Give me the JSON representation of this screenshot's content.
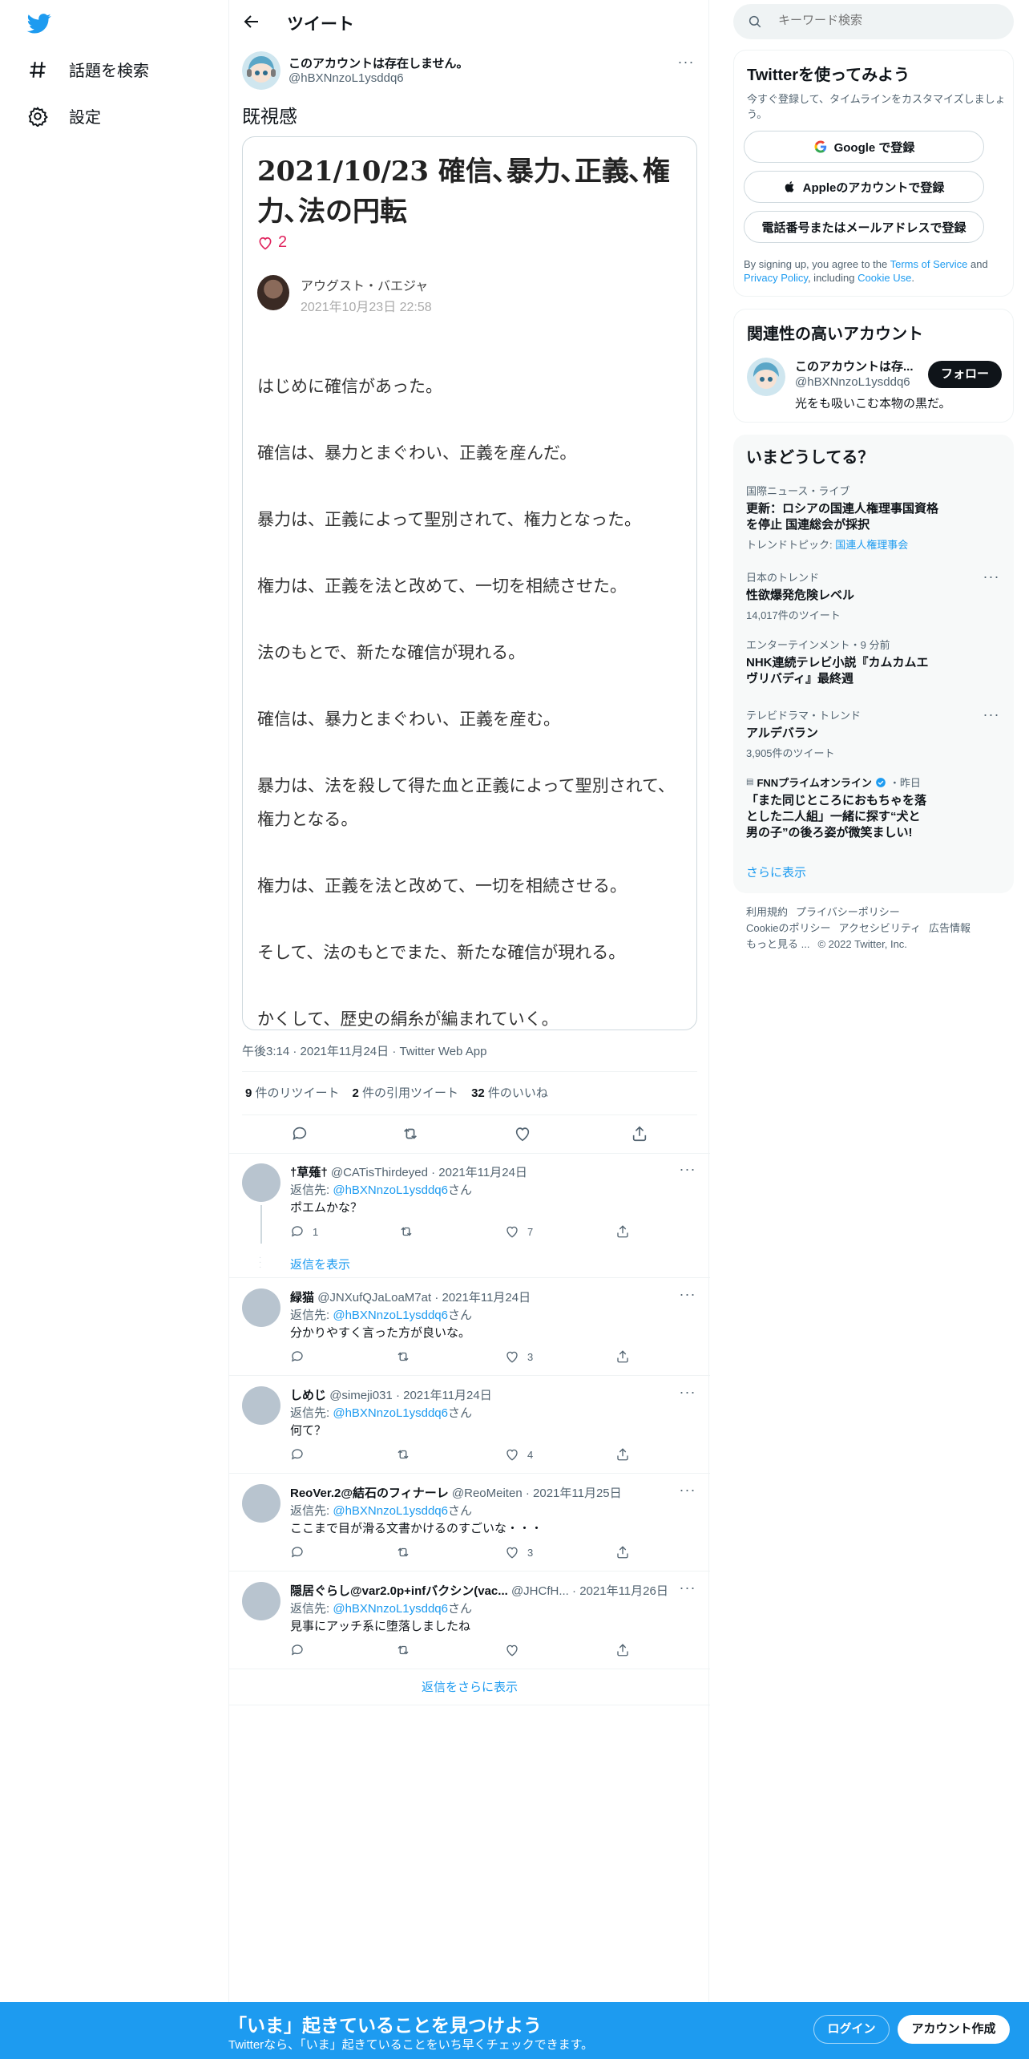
{
  "nav": {
    "explore_label": "話題を検索",
    "settings_label": "設定"
  },
  "header": {
    "title": "ツイート"
  },
  "tweet": {
    "author_name": "このアカウントは存在しません。",
    "author_handle": "@hBXNnzoL1ysddq6",
    "text": "既視感",
    "card": {
      "title": "2021/10/23 確信､暴力､正義､権力､法の円転",
      "likes": "2",
      "author": "アウグスト・バエジャ",
      "date": "2021年10月23日 22:58",
      "paragraphs": [
        "はじめに確信があった。",
        "確信は、暴力とまぐわい、正義を産んだ。",
        "暴力は、正義によって聖別されて、権力となった。",
        "権力は、正義を法と改めて、一切を相続させた。",
        "法のもとで、新たな確信が現れる。",
        "確信は、暴力とまぐわい、正義を産む。",
        "暴力は、法を殺して得た血と正義によって聖別されて、権力となる。",
        "権力は、正義を法と改めて、一切を相続させる。",
        "そして、法のもとでまた、新たな確信が現れる。",
        "かくして、歴史の絹糸が編まれていく。"
      ]
    },
    "meta": "午後3:14 · 2021年11月24日 · Twitter Web App",
    "stats": {
      "retweets_num": "9",
      "retweets_label": "件のリツイート",
      "quotes_num": "2",
      "quotes_label": "件の引用ツイート",
      "likes_num": "32",
      "likes_label": "件のいいね"
    }
  },
  "replies": [
    {
      "name": "†草薙†",
      "handle": "@CATisThirdeyed",
      "date": "· 2021年11月24日",
      "reply_prefix": "返信先: ",
      "reply_to": "@hBXNnzoL1ysddq6",
      "reply_suffix": "さん",
      "text": "ポエムかな？",
      "reply_count": "1",
      "like_count": "7"
    },
    {
      "name": "緑猫",
      "handle": "@JNXufQJaLoaM7at",
      "date": "· 2021年11月24日",
      "reply_prefix": "返信先: ",
      "reply_to": "@hBXNnzoL1ysddq6",
      "reply_suffix": "さん",
      "text": "分かりやすく言った方が良いな。",
      "reply_count": "",
      "like_count": "3"
    },
    {
      "name": "しめじ",
      "handle": "@simeji031",
      "date": "· 2021年11月24日",
      "reply_prefix": "返信先: ",
      "reply_to": "@hBXNnzoL1ysddq6",
      "reply_suffix": "さん",
      "text": "何て？",
      "reply_count": "",
      "like_count": "4"
    },
    {
      "name": "ReoVer.2@結石のフィナーレ",
      "handle": "@ReoMeiten",
      "date": "· 2021年11月25日",
      "reply_prefix": "返信先: ",
      "reply_to": "@hBXNnzoL1ysddq6",
      "reply_suffix": "さん",
      "text": "ここまで目が滑る文書かけるのすごいな・・・",
      "reply_count": "",
      "like_count": "3"
    },
    {
      "name": "隠居ぐらし@var2.0p+infバクシン(vac...",
      "handle": "@JHCfH...",
      "date": "· 2021年11月26日",
      "reply_prefix": "返信先: ",
      "reply_to": "@hBXNnzoL1ysddq6",
      "reply_suffix": "さん",
      "text": "見事にアッチ系に堕落しましたね",
      "reply_count": "",
      "like_count": ""
    }
  ],
  "show_replies_label": "返信を表示",
  "more_replies_label": "返信をさらに表示",
  "search": {
    "placeholder": "キーワード検索"
  },
  "signup_box": {
    "title": "Twitterを使ってみよう",
    "subtitle": "今すぐ登録して、タイムラインをカスタマイズしましょう。",
    "google": "Google で登録",
    "apple": "Appleのアカウントで登録",
    "phone": "電話番号またはメールアドレスで登録",
    "terms_1": "By signing up, you agree to the ",
    "terms_link1": "Terms of Service",
    "terms_2": " and ",
    "terms_link2": "Privacy Policy",
    "terms_3": ", including ",
    "terms_link3": "Cookie Use",
    "terms_4": "."
  },
  "related": {
    "title": "関連性の高いアカウント",
    "name": "このアカウントは存...",
    "handle": "@hBXNnzoL1ysddq6",
    "bio": "光をも吸いこむ本物の黒だ。",
    "follow": "フォロー"
  },
  "trends": {
    "title": "いまどうしてる？",
    "items": [
      {
        "cat": "国際ニュース・ライブ",
        "title": "更新：ロシアの国連人権理事国資格を停止 国連総会が採択",
        "sub_label": "トレンドトピック: ",
        "sub_link": "国連人権理事会"
      },
      {
        "cat": "日本のトレンド",
        "title": "性欲爆発危険レベル",
        "sub": "14,017件のツイート"
      },
      {
        "cat": "エンターテインメント・9 分前",
        "title": "NHK連続テレビ小説『カムカムエヴリバディ』最終週"
      },
      {
        "cat": "テレビドラマ・トレンド",
        "title": "アルデバラン",
        "sub": "3,905件のツイート"
      },
      {
        "cat": "FNNプライムオンライン",
        "cat_suffix": "・昨日",
        "title": "「また同じところにおもちゃを落とした二人組」一緒に探す“犬と男の子”の後ろ姿が微笑ましい!"
      }
    ],
    "more": "さらに表示"
  },
  "footer": {
    "terms": "利用規約",
    "privacy": "プライバシーポリシー",
    "cookie": "Cookieのポリシー",
    "accessibility": "アクセシビリティ",
    "ads": "広告情報",
    "more": "もっと見る ...",
    "copyright": "© 2022 Twitter, Inc."
  },
  "bottom_bar": {
    "title": "「いま」起きていることを見つけよう",
    "subtitle": "Twitterなら、「いま」起きていることをいち早くチェックできます。",
    "login": "ログイン",
    "signup": "アカウント作成"
  },
  "colors": {
    "brand": "#1d9bf0",
    "like": "#e0245e",
    "text": "#0f1419",
    "muted": "#536471"
  }
}
